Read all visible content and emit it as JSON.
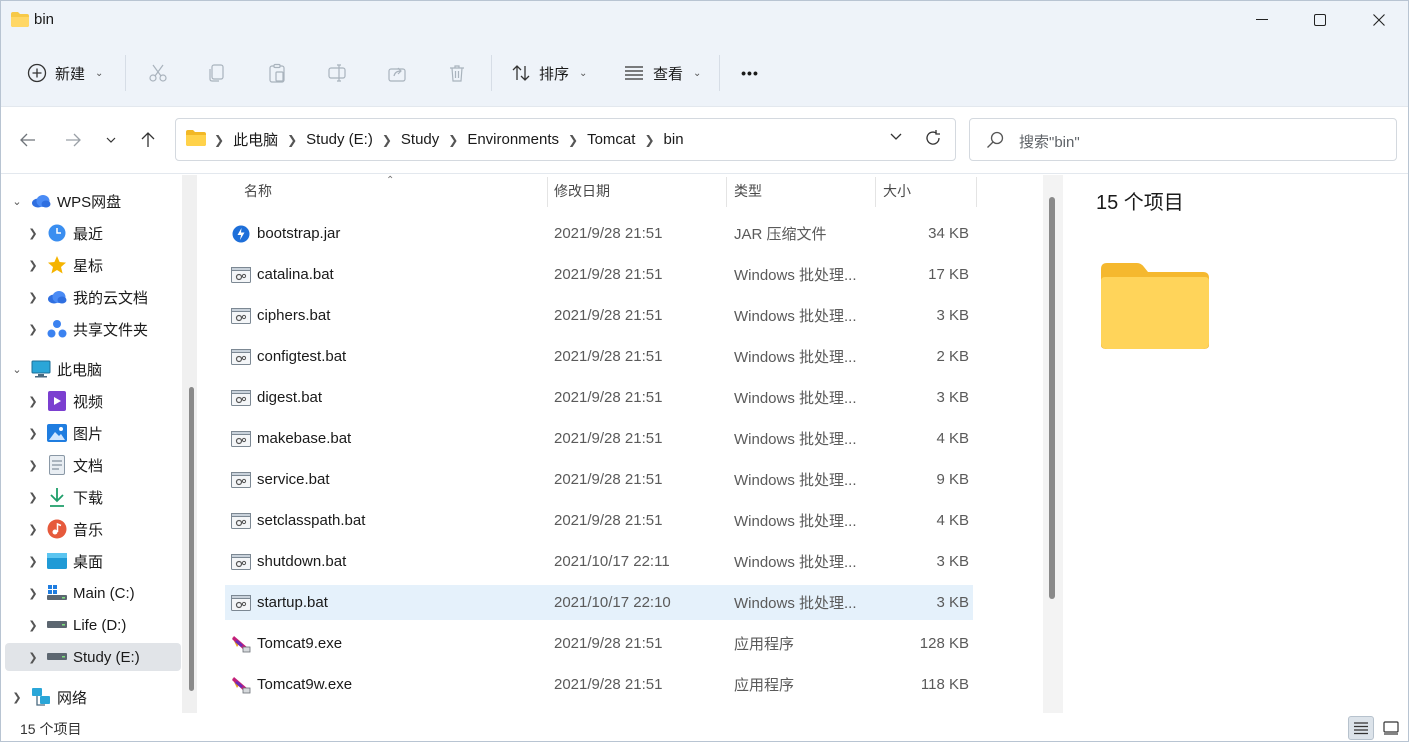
{
  "window": {
    "title": "bin",
    "minimize_label": "minimize",
    "maximize_label": "maximize",
    "close_label": "close"
  },
  "toolbar": {
    "new_label": "新建",
    "sort_label": "排序",
    "view_label": "查看",
    "more_label": "•••"
  },
  "address": {
    "crumbs": [
      "此电脑",
      "Study (E:)",
      "Study",
      "Environments",
      "Tomcat",
      "bin"
    ],
    "search_placeholder": "搜索\"bin\""
  },
  "sidebar": {
    "items": [
      {
        "label": "WPS网盘",
        "icon": "wps-cloud-icon",
        "expanded": true,
        "level": 0
      },
      {
        "label": "最近",
        "icon": "clock-icon",
        "expanded": false,
        "level": 1
      },
      {
        "label": "星标",
        "icon": "star-icon",
        "expanded": false,
        "level": 1
      },
      {
        "label": "我的云文档",
        "icon": "cloud-icon",
        "expanded": false,
        "level": 1
      },
      {
        "label": "共享文件夹",
        "icon": "share-icon",
        "expanded": false,
        "level": 1
      },
      {
        "label": "此电脑",
        "icon": "monitor-icon",
        "expanded": true,
        "level": 0
      },
      {
        "label": "视频",
        "icon": "video-icon",
        "expanded": false,
        "level": 1
      },
      {
        "label": "图片",
        "icon": "picture-icon",
        "expanded": false,
        "level": 1
      },
      {
        "label": "文档",
        "icon": "document-icon",
        "expanded": false,
        "level": 1
      },
      {
        "label": "下载",
        "icon": "download-icon",
        "expanded": false,
        "level": 1
      },
      {
        "label": "音乐",
        "icon": "music-icon",
        "expanded": false,
        "level": 1
      },
      {
        "label": "桌面",
        "icon": "desktop-icon",
        "expanded": false,
        "level": 1
      },
      {
        "label": "Main (C:)",
        "icon": "windows-drive-icon",
        "expanded": false,
        "level": 1
      },
      {
        "label": "Life (D:)",
        "icon": "drive-icon",
        "expanded": false,
        "level": 1
      },
      {
        "label": "Study (E:)",
        "icon": "drive-icon",
        "expanded": false,
        "level": 1,
        "selected": true
      },
      {
        "label": "网络",
        "icon": "network-icon",
        "expanded": false,
        "level": 0
      }
    ]
  },
  "filelist": {
    "columns": {
      "name": "名称",
      "date": "修改日期",
      "type": "类型",
      "size": "大小"
    },
    "rows": [
      {
        "name": "bootstrap.jar",
        "date": "2021/9/28 21:51",
        "type": "JAR 压缩文件",
        "size": "34 KB",
        "icon": "jar-icon"
      },
      {
        "name": "catalina.bat",
        "date": "2021/9/28 21:51",
        "type": "Windows 批处理...",
        "size": "17 KB",
        "icon": "bat-icon"
      },
      {
        "name": "ciphers.bat",
        "date": "2021/9/28 21:51",
        "type": "Windows 批处理...",
        "size": "3 KB",
        "icon": "bat-icon"
      },
      {
        "name": "configtest.bat",
        "date": "2021/9/28 21:51",
        "type": "Windows 批处理...",
        "size": "2 KB",
        "icon": "bat-icon"
      },
      {
        "name": "digest.bat",
        "date": "2021/9/28 21:51",
        "type": "Windows 批处理...",
        "size": "3 KB",
        "icon": "bat-icon"
      },
      {
        "name": "makebase.bat",
        "date": "2021/9/28 21:51",
        "type": "Windows 批处理...",
        "size": "4 KB",
        "icon": "bat-icon"
      },
      {
        "name": "service.bat",
        "date": "2021/9/28 21:51",
        "type": "Windows 批处理...",
        "size": "9 KB",
        "icon": "bat-icon"
      },
      {
        "name": "setclasspath.bat",
        "date": "2021/9/28 21:51",
        "type": "Windows 批处理...",
        "size": "4 KB",
        "icon": "bat-icon"
      },
      {
        "name": "shutdown.bat",
        "date": "2021/10/17 22:11",
        "type": "Windows 批处理...",
        "size": "3 KB",
        "icon": "bat-icon"
      },
      {
        "name": "startup.bat",
        "date": "2021/10/17 22:10",
        "type": "Windows 批处理...",
        "size": "3 KB",
        "icon": "bat-icon",
        "selected": true
      },
      {
        "name": "Tomcat9.exe",
        "date": "2021/9/28 21:51",
        "type": "应用程序",
        "size": "128 KB",
        "icon": "tomcat-exe-icon"
      },
      {
        "name": "Tomcat9w.exe",
        "date": "2021/9/28 21:51",
        "type": "应用程序",
        "size": "118 KB",
        "icon": "tomcat-exe-icon"
      }
    ]
  },
  "details": {
    "item_count": "15 个项目"
  },
  "status": {
    "item_count": "15 个项目"
  },
  "colors": {
    "chrome_bg": "#eef3f9",
    "selection_bg": "#e5f1fb",
    "folder_yellow": "#ffc83d"
  }
}
